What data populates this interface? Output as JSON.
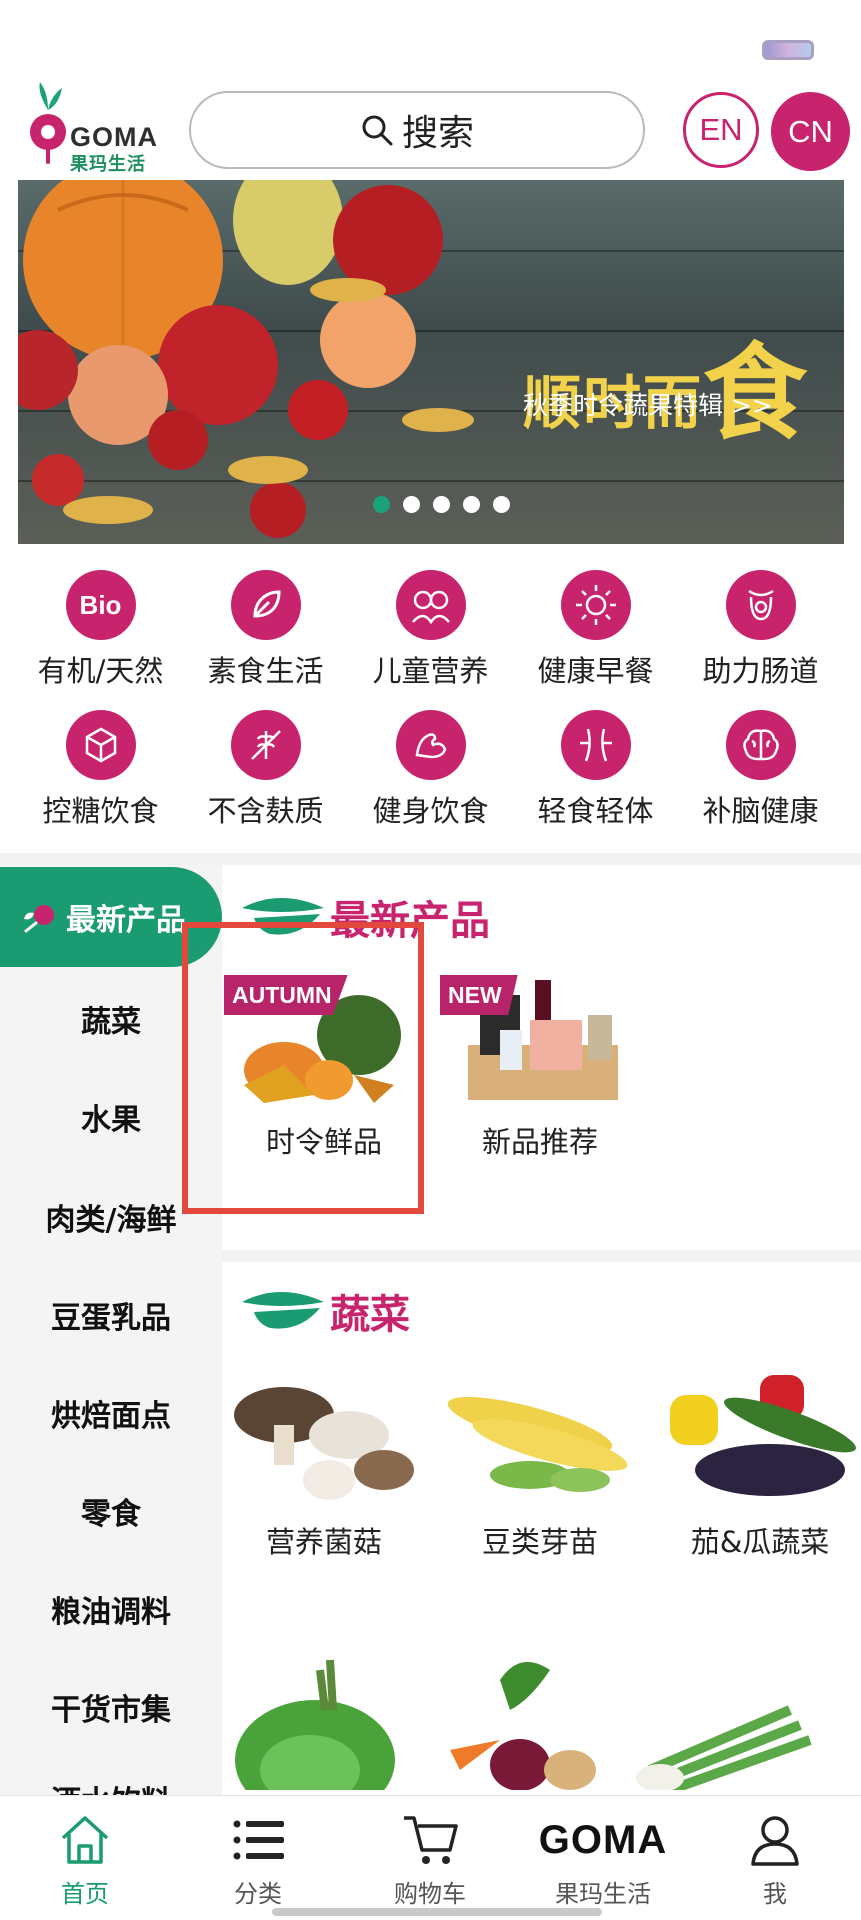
{
  "header": {
    "logo_text": "GOMA",
    "logo_subtitle": "果玛生活",
    "search_label": "搜索",
    "lang_en": "EN",
    "lang_cn": "CN"
  },
  "banner": {
    "title_small": "顺时而",
    "title_big": "食",
    "subtitle": "秋季时令蔬果特辑 >>",
    "slide_count": 5,
    "active_slide": 1
  },
  "categories": [
    {
      "label": "有机/天然",
      "icon": "bio-icon"
    },
    {
      "label": "素食生活",
      "icon": "leaf-icon"
    },
    {
      "label": "儿童营养",
      "icon": "children-icon"
    },
    {
      "label": "健康早餐",
      "icon": "sun-icon"
    },
    {
      "label": "助力肠道",
      "icon": "gut-icon"
    },
    {
      "label": "控糖饮食",
      "icon": "sugar-cube-icon"
    },
    {
      "label": "不含麸质",
      "icon": "no-wheat-icon"
    },
    {
      "label": "健身饮食",
      "icon": "muscle-icon"
    },
    {
      "label": "轻食轻体",
      "icon": "waist-icon"
    },
    {
      "label": "补脑健康",
      "icon": "brain-icon"
    }
  ],
  "sidebar": {
    "active": "最新产品",
    "items": [
      "蔬菜",
      "水果",
      "肉类/海鲜",
      "豆蛋乳品",
      "烘焙面点",
      "零食",
      "粮油调料",
      "干货市集",
      "酒水饮料"
    ]
  },
  "sections": {
    "latest": {
      "title": "最新产品",
      "items": [
        {
          "label": "时令鲜品",
          "tag": "AUTUMN"
        },
        {
          "label": "新品推荐",
          "tag": "NEW"
        }
      ]
    },
    "vegetables": {
      "title": "蔬菜",
      "items": [
        {
          "label": "营养菌菇"
        },
        {
          "label": "豆类芽苗"
        },
        {
          "label": "茄&瓜蔬菜"
        }
      ]
    }
  },
  "tabbar": {
    "items": [
      {
        "label": "首页",
        "icon": "home-icon",
        "active": true
      },
      {
        "label": "分类",
        "icon": "list-icon"
      },
      {
        "label": "购物车",
        "icon": "cart-icon"
      },
      {
        "label": "果玛生活",
        "icon": "goma-wordmark",
        "brand": "GOMA"
      },
      {
        "label": "我",
        "icon": "person-icon"
      }
    ]
  },
  "colors": {
    "brand_magenta": "#c8246e",
    "brand_green": "#1a9b72",
    "highlight_red": "#e2483d"
  }
}
